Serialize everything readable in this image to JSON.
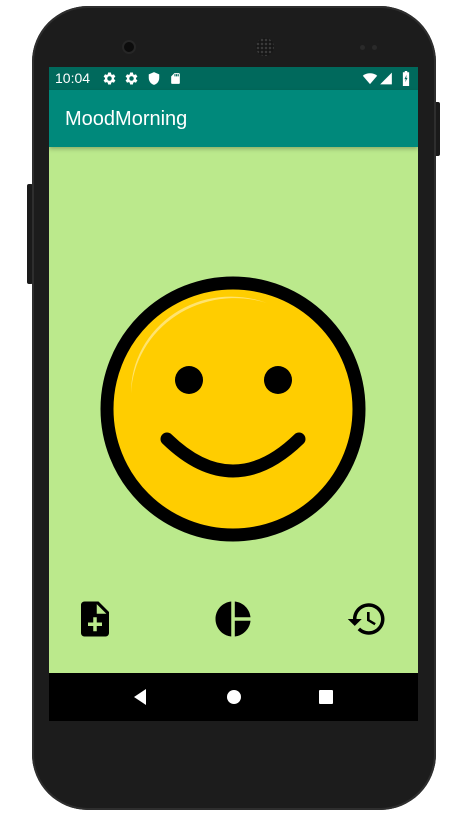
{
  "status_bar": {
    "time": "10:04",
    "icons": [
      "settings-icon",
      "settings-icon",
      "shield-icon",
      "sd-card-icon",
      "wifi-icon",
      "signal-icon",
      "battery-icon"
    ]
  },
  "app_bar": {
    "title": "MoodMorning"
  },
  "mood": {
    "icon": "smiley-face-icon",
    "face_color": "#ffcd00",
    "background_color": "#bbe98c"
  },
  "actions": [
    {
      "name": "add-note-button",
      "icon": "note-add-icon"
    },
    {
      "name": "statistics-button",
      "icon": "pie-chart-icon"
    },
    {
      "name": "history-button",
      "icon": "history-icon"
    }
  ],
  "nav_bar": {
    "buttons": [
      "back-icon",
      "home-icon",
      "recents-icon"
    ]
  },
  "colors": {
    "primary": "#00897b",
    "primary_dark": "#00695c"
  }
}
